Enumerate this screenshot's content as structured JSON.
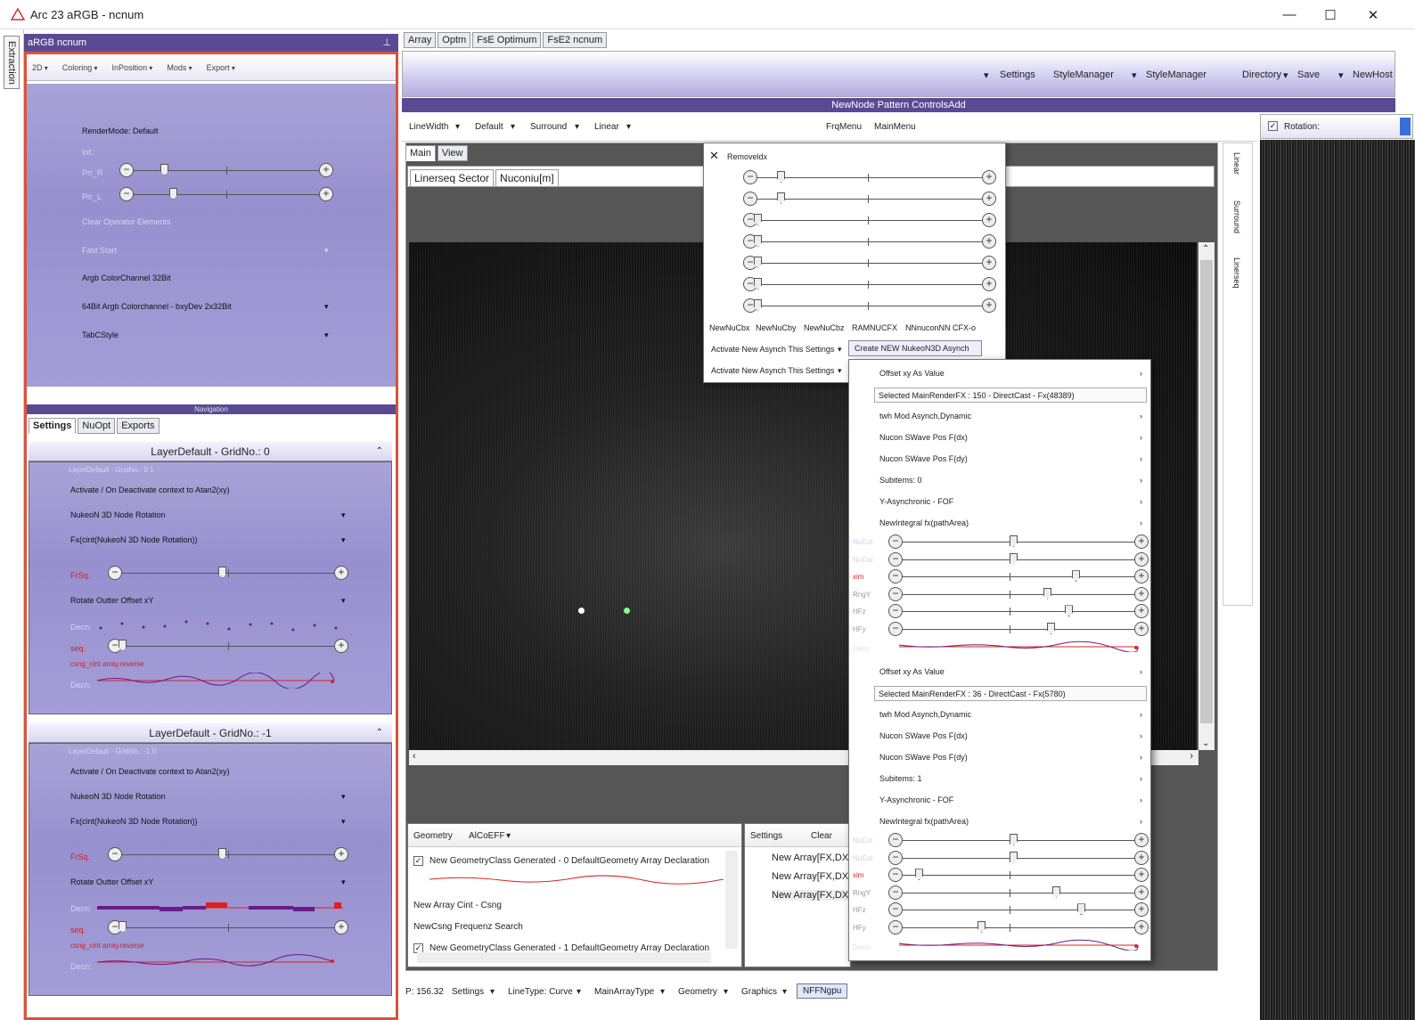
{
  "window": {
    "title": "Arc 23 aRGB - ncnum",
    "minimize": "—",
    "maximize": "☐",
    "close": "✕"
  },
  "side_tab": "Extraction",
  "left": {
    "panel_title": "aRGB ncnum",
    "menu": [
      "2D",
      "Coloring",
      "InPosition",
      "Mods",
      "Export"
    ],
    "render_mode": "RenderMode: Default",
    "inf": "Inf.:",
    "prr": "Prr_R",
    "prl": "Prr_L",
    "clear": "Clear Operator Elements",
    "fast_start": "Fast Start",
    "argb32": "Argb ColorChannel 32Bit",
    "argb64": "64Bit Argb Colorchannel - bxyDev 2x32Bit",
    "tabcstyle": "TabCStyle",
    "navigation": "Navigation",
    "tabs": [
      "Settings",
      "NuOpt",
      "Exports"
    ],
    "grid0": {
      "title": "LayerDefault - GridNo.: 0",
      "sub": "LayerDefault - GridNo.: 0 1",
      "activate": "Activate / On Deactivate context to Atan2(xy)",
      "nrot": "NukeoN 3D Node Rotation",
      "fx": "Fx(cint(NukeoN 3D Node Rotation))",
      "frsq": "FrSq.",
      "rotate": "Rotate Outter Offset xY",
      "decn": "Decn:",
      "seq": "seq.",
      "csng": "csng_cint array.reverse"
    },
    "grid1": {
      "title": "LayerDefault - GridNo.: -1",
      "sub": "LayerDefault - GridNo.: -1 0",
      "activate": "Activate / On Deactivate context to Atan2(xy)",
      "nrot": "NukeoN 3D Node Rotation",
      "fx": "Fx(cint(NukeoN 3D Node Rotation))",
      "frsq": "FrSq.",
      "rotate": "Rotate Outter Offset xY",
      "decn": "Decn:",
      "seq": "seq.",
      "csng": "csng_cint array.reverse"
    }
  },
  "top_tabs": [
    "Array",
    "Optm",
    "FsE Optimum",
    "FsE2 ncnum"
  ],
  "toolbar": [
    "Settings",
    "StyleManager",
    "StyleManager",
    "Directory",
    "Save",
    "NewHost"
  ],
  "node_bar": "NewNode Pattern ControlsAdd",
  "tb2": [
    "LineWidth",
    "Default",
    "Surround",
    "Linear"
  ],
  "tb2_right": [
    "FrqMenu",
    "MainMenu"
  ],
  "rotation": "Rotation:",
  "vertical": [
    "Linear",
    "Surround",
    "Linerseq"
  ],
  "main_tabs": [
    "Main",
    "View"
  ],
  "sector_tabs": [
    "Linerseq Sector",
    "Nuconiu[m]"
  ],
  "popup1": {
    "close": "✕",
    "title": "Removeldx",
    "labels": [
      "NewNuCbx",
      "NewNuCby",
      "NewNuCbz",
      "RAMNUCFX",
      "NNnuconNN CFX-o"
    ],
    "act1": "Activate New Asynch This Settings",
    "act2": "Activate New Asynch This Settings",
    "create": "Create NEW NukeoN3D Asynch"
  },
  "popup2": {
    "s1": {
      "offset": "Offset xy As Value",
      "selected": "Selected MainRenderFX : 150 - DirectCast - Fx(48389)",
      "twh": "twh Mod Asynch,Dynamic",
      "dx": "Nucon SWave Pos F(dx)",
      "dy": "Nucon SWave Pos F(dy)",
      "sub": "Subitems: 0",
      "yas": "Y-Asynchronic - FOF",
      "ni": "NewIntegral fx(pathArea)",
      "sl": [
        "NuCol",
        "NuCol",
        "xim",
        "RngY",
        "HFz",
        "HFy"
      ],
      "decn": "Decn:"
    },
    "s2": {
      "offset": "Offset xy As Value",
      "selected": "Selected MainRenderFX : 36 - DirectCast - Fx(5780)",
      "twh": "twh Mod Asynch,Dynamic",
      "dx": "Nucon SWave Pos F(dx)",
      "dy": "Nucon SWave Pos F(dy)",
      "sub": "Subitems: 1",
      "yas": "Y-Asynchronic - FOF",
      "ni": "NewIntegral fx(pathArea)",
      "sl": [
        "NuCol",
        "NuCol",
        "xim",
        "RngY",
        "HFz",
        "HFy"
      ],
      "decn": "Decn:"
    }
  },
  "bottom": {
    "menu": [
      "Geometry",
      "AlCoEFF"
    ],
    "i1": "New GeometryClass Generated - 0 DefaultGeometry Array Declaration",
    "i2": "New Array Cint - Csng",
    "i3": "NewCsng Frequenz Search",
    "i4": "New GeometryClass Generated - 1 DefaultGeometry Array Declaration",
    "menu2": [
      "Settings",
      "Clear"
    ],
    "arr": [
      "New Array[FX,DX",
      "New Array[FX,DX",
      "New Array[FX,DX"
    ]
  },
  "status": {
    "p": "P: 156.32",
    "items": [
      "Settings",
      "LineType: Curve",
      "MainArrayType",
      "Geometry",
      "Graphics"
    ],
    "btn": "NFFNgpu"
  },
  "colors": {
    "accent": "#5a4a94",
    "lavender": "#a39dd7",
    "red_border": "#d9533c"
  }
}
